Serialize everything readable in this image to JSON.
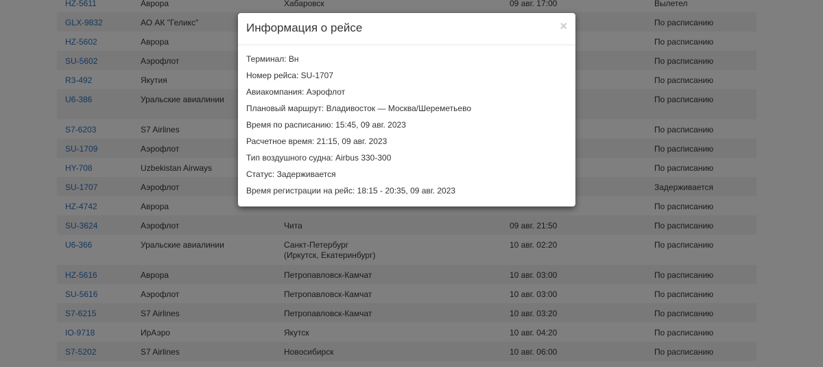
{
  "flights": [
    {
      "flight": "HZ-5611",
      "airline": "Аврора",
      "route": "Хабаровск",
      "route2": "",
      "time": "09 авг. 17:00",
      "status": "Вылетел"
    },
    {
      "flight": "GLX-9832",
      "airline": "АО АК \"Геликс\"",
      "route": "",
      "route2": "",
      "time": "",
      "status": "По расписанию"
    },
    {
      "flight": "HZ-5602",
      "airline": "Аврора",
      "route": "",
      "route2": "",
      "time": "",
      "status": "По расписанию"
    },
    {
      "flight": "SU-5602",
      "airline": "Аэрофлот",
      "route": "",
      "route2": "",
      "time": "",
      "status": "По расписанию"
    },
    {
      "flight": "R3-492",
      "airline": "Якутия",
      "route": "",
      "route2": "",
      "time": "",
      "status": "По расписанию"
    },
    {
      "flight": "U6-386",
      "airline": "Уральские авиалинии",
      "route": "",
      "route2": "",
      "time": "",
      "status": "По расписанию"
    },
    {
      "flight": "S7-6203",
      "airline": "S7 Airlines",
      "route": "",
      "route2": "",
      "time": "",
      "status": "По расписанию"
    },
    {
      "flight": "SU-1709",
      "airline": "Аэрофлот",
      "route": "",
      "route2": "",
      "time": "",
      "status": "По расписанию"
    },
    {
      "flight": "HY-708",
      "airline": "Uzbekistan Airways",
      "route": "",
      "route2": "",
      "time": "",
      "status": "По расписанию"
    },
    {
      "flight": "SU-1707",
      "airline": "Аэрофлот",
      "route": "",
      "route2": "",
      "time": "",
      "status": "Задерживается"
    },
    {
      "flight": "HZ-4742",
      "airline": "Аврора",
      "route": "",
      "route2": "",
      "time": "",
      "status": "По расписанию"
    },
    {
      "flight": "SU-3624",
      "airline": "Аэрофлот",
      "route": "Чита",
      "route2": "",
      "time": "09 авг. 21:50",
      "status": "По расписанию"
    },
    {
      "flight": "U6-366",
      "airline": "Уральские авиалинии",
      "route": "Санкт-Петербург",
      "route2": "(Иркутск, Екатеринбург)",
      "time": "10 авг. 02:20",
      "status": "По расписанию"
    },
    {
      "flight": "HZ-5616",
      "airline": "Аврора",
      "route": "Петропавловск-Камчат",
      "route2": "",
      "time": "10 авг. 03:00",
      "status": "По расписанию"
    },
    {
      "flight": "SU-5616",
      "airline": "Аэрофлот",
      "route": "Петропавловск-Камчат",
      "route2": "",
      "time": "10 авг. 03:00",
      "status": "По расписанию"
    },
    {
      "flight": "S7-6215",
      "airline": "S7 Airlines",
      "route": "Петропавловск-Камчат",
      "route2": "",
      "time": "10 авг. 03:20",
      "status": "По расписанию"
    },
    {
      "flight": "IO-9718",
      "airline": "ИрАэро",
      "route": "Якутск",
      "route2": "",
      "time": "10 авг. 04:20",
      "status": "По расписанию"
    },
    {
      "flight": "S7-5202",
      "airline": "S7 Airlines",
      "route": "Новосибирск",
      "route2": "",
      "time": "10 авг. 06:00",
      "status": "По расписанию"
    }
  ],
  "modal": {
    "title": "Информация о рейсе",
    "close": "×",
    "lines": [
      "Терминал: Вн",
      "Номер рейса: SU-1707",
      "Авиакомпания: Аэрофлот",
      "Плановый маршрут: Владивосток — Москва/Шереметьево",
      "Время по расписанию: 15:45, 09 авг. 2023",
      "Расчетное время: 21:15, 09 авг. 2023",
      "Тип воздушного судна: Airbus 330-300",
      "Статус: Задерживается",
      "Время регистрации на рейс: 18:15 - 20:35, 09 авг. 2023"
    ]
  },
  "colors": {
    "link": "#2a6fb8",
    "overlay": "rgba(0,0,0,0.5)"
  }
}
